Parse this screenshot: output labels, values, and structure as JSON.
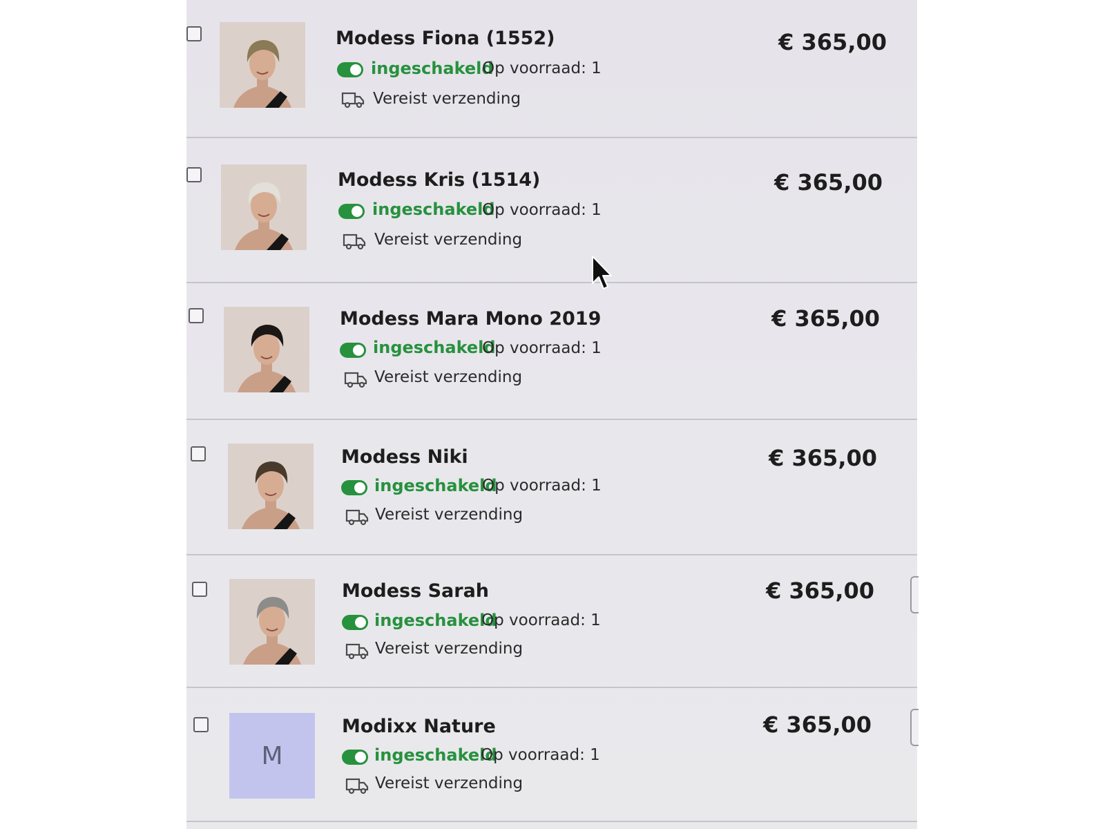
{
  "products": [
    {
      "name": "Modess Fiona (1552)",
      "status": "ingeschakeld",
      "stock": "Op voorraad: 1",
      "shipping": "Vereist verzending",
      "price": "€ 365,00",
      "thumb": {
        "type": "photo",
        "hair": "#8a7a55"
      }
    },
    {
      "name": "Modess Kris (1514)",
      "status": "ingeschakeld",
      "stock": "Op voorraad: 1",
      "shipping": "Vereist verzending",
      "price": "€ 365,00",
      "thumb": {
        "type": "photo",
        "hair": "#e2e0d8"
      }
    },
    {
      "name": "Modess Mara Mono 2019",
      "status": "ingeschakeld",
      "stock": "Op voorraad: 1",
      "shipping": "Vereist verzending",
      "price": "€ 365,00",
      "thumb": {
        "type": "photo",
        "hair": "#1c1614"
      }
    },
    {
      "name": "Modess Niki",
      "status": "ingeschakeld",
      "stock": "Op voorraad: 1",
      "shipping": "Vereist verzending",
      "price": "€ 365,00",
      "thumb": {
        "type": "photo",
        "hair": "#4a3a2c"
      }
    },
    {
      "name": "Modess Sarah",
      "status": "ingeschakeld",
      "stock": "Op voorraad: 1",
      "shipping": "Vereist verzending",
      "price": "€ 365,00",
      "thumb": {
        "type": "photo",
        "hair": "#8c8c88"
      }
    },
    {
      "name": "Modixx Nature",
      "status": "ingeschakeld",
      "stock": "Op voorraad: 1",
      "shipping": "Vereist verzending",
      "price": "€ 365,00",
      "thumb": {
        "type": "letter",
        "letter": "M"
      }
    }
  ],
  "icons": {
    "status_toggle": "toggle-on-icon",
    "shipping": "truck-icon",
    "pointer": "mouse-cursor-icon"
  },
  "colors": {
    "status_green": "#27913e",
    "letter_thumb_bg": "#c3c4ee"
  }
}
